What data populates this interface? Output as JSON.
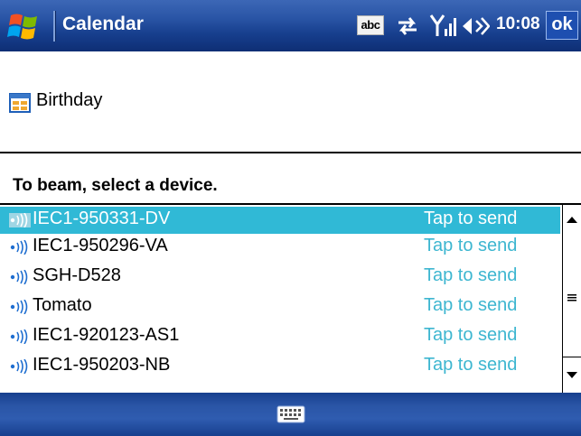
{
  "title_bar": {
    "app_title": "Calendar",
    "input_mode": "abc",
    "clock": "10:08",
    "ok_label": "ok"
  },
  "item": {
    "label": "Birthday"
  },
  "beam": {
    "prompt": "To beam, select a device.",
    "devices": [
      {
        "name": "IEC1-950331-DV",
        "action": "Tap to send",
        "selected": true
      },
      {
        "name": "IEC1-950296-VA",
        "action": "Tap to send",
        "selected": false
      },
      {
        "name": "SGH-D528",
        "action": "Tap to send",
        "selected": false
      },
      {
        "name": "Tomato",
        "action": "Tap to send",
        "selected": false
      },
      {
        "name": "IEC1-920123-AS1",
        "action": "Tap to send",
        "selected": false
      },
      {
        "name": "IEC1-950203-NB",
        "action": "Tap to send",
        "selected": false
      }
    ]
  },
  "colors": {
    "title_bar": "#2a55a6",
    "selection": "#30b9d6",
    "action_text": "#3db6d0"
  },
  "icons": {
    "start": "windows-flag-icon",
    "sync": "sync-arrows-icon",
    "signal": "signal-strength-icon",
    "volume": "speaker-icon",
    "item": "calendar-icon",
    "device": "bluetooth-device-icon",
    "keyboard": "keyboard-icon"
  }
}
